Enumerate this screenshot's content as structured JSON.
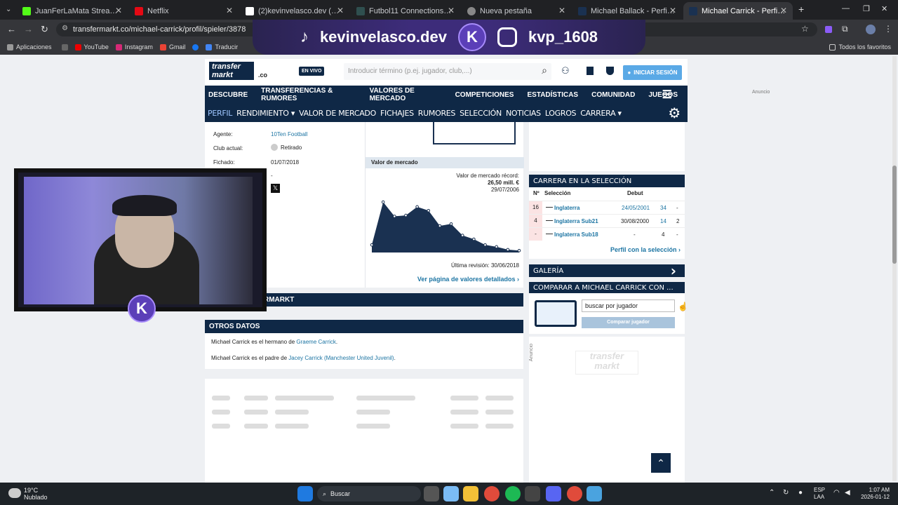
{
  "browser": {
    "tabs": [
      {
        "label": "JuanFerLaMata Stream - Watch",
        "color": "#53fc18"
      },
      {
        "label": "Netflix",
        "color": "#e50914"
      },
      {
        "label": "(2)kevinvelasco.dev (@kevinvel",
        "color": "#111111"
      },
      {
        "label": "Futbol11 Connections - Play Fo",
        "color": "#2f4f4f"
      },
      {
        "label": "Nueva pestaña",
        "color": "#888888"
      },
      {
        "label": "Michael Ballack - Perfil del juga",
        "color": "#1a3151"
      },
      {
        "label": "Michael Carrick - Perfil del juga",
        "color": "#1a3151"
      }
    ],
    "url": "transfermarkt.co/michael-carrick/profil/spieler/3878",
    "bookmarks": [
      "Aplicaciones",
      "YouTube",
      "Instagram",
      "Gmail",
      "Traducir"
    ],
    "bookmarks_all": "Todos los favoritos"
  },
  "overlay": {
    "tiktok": "kevinvelasco.dev",
    "instagram": "kvp_1608",
    "logo_letter": "K"
  },
  "site": {
    "logo_top": "transfer",
    "logo_bottom": "markt",
    "logo_domain": ".co",
    "live_badge": "EN VIVO",
    "search_placeholder": "Introducir término (p.ej. jugador, club,...)",
    "login_button": "INICIAR SESIÓN",
    "nav_main": [
      "DESCUBRE",
      "TRANSFERENCIAS & RUMORES",
      "VALORES DE MERCADO",
      "COMPETICIONES",
      "ESTADÍSTICAS",
      "COMUNIDAD",
      "JUEGOS"
    ],
    "nav_sub": [
      "PERFIL",
      "RENDIMIENTO ▾",
      "VALOR DE MERCADO",
      "FICHAJES",
      "RUMORES",
      "SELECCIÓN",
      "NOTICIAS",
      "LOGROS",
      "CARRERA ▾"
    ]
  },
  "ad_label": "Anuncio",
  "profile": {
    "rows": [
      {
        "label": "Agente:",
        "value": "10Ten Football",
        "is_link": true
      },
      {
        "label": "Club actual:",
        "value": "Retirado",
        "is_link": false
      },
      {
        "label": "Fichado:",
        "value": "01/07/2018",
        "is_link": false
      },
      {
        "label": "",
        "value": "-",
        "is_link": false
      }
    ]
  },
  "market_value": {
    "title": "Valor de mercado",
    "record_label": "Valor de mercado récord:",
    "record_value": "26,50 mill. €",
    "record_date": "29/07/2006",
    "last_revision": "Última revisión: 30/06/2018",
    "detail_link": "Ver página de valores detallados"
  },
  "chart_data": {
    "type": "area",
    "color": "#1a3151",
    "values": [
      4,
      26.5,
      19,
      19.5,
      24,
      22,
      14,
      15,
      9,
      7,
      4,
      3,
      1.5,
      1
    ]
  },
  "national": {
    "title": "CARRERA EN LA SELECCIÓN",
    "headers": [
      "Nº",
      "Selección",
      "Debut"
    ],
    "rows": [
      {
        "num": "16",
        "team": "Inglaterra",
        "debut": "24/05/2001",
        "apps": "34",
        "goals": "-"
      },
      {
        "num": "4",
        "team": "Inglaterra Sub21",
        "debut": "30/08/2000",
        "apps": "14",
        "goals": "2"
      },
      {
        "num": "-",
        "team": "Inglaterra Sub18",
        "debut": "-",
        "apps": "4",
        "goals": "-"
      }
    ],
    "link": "Perfil con la selección"
  },
  "gallery_title": "GALERÍA",
  "compare": {
    "title": "COMPARAR A MICHAEL CARRICK CON ...",
    "input_value": "buscar por jugador",
    "button": "Comparar jugador"
  },
  "tm_partial": "RMARKT",
  "other": {
    "title": "OTROS DATOS",
    "line1_prefix": "Michael Carrick es el hermano de ",
    "line1_link": "Graeme Carrick",
    "line1_suffix": ".",
    "line2_prefix": "Michael Carrick es el padre de ",
    "line2_link": "Jacey Carrick (Manchester United Juvenil)",
    "line2_suffix": "."
  },
  "taskbar": {
    "temp": "19°C",
    "weather": "Nublado",
    "search": "Buscar",
    "lang1": "ESP",
    "lang2": "LAA",
    "time": "1:07 AM",
    "date": "2026-01-12"
  }
}
